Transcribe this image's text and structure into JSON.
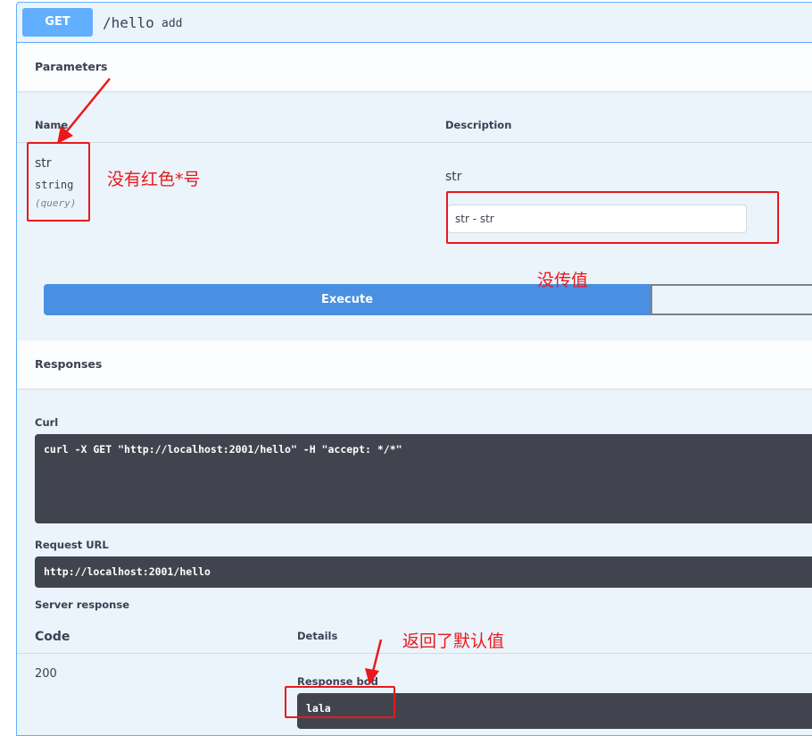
{
  "endpoint": {
    "method": "GET",
    "path": "/hello",
    "summary": "add"
  },
  "parameters": {
    "title": "Parameters",
    "name_header": "Name",
    "description_header": "Description",
    "items": [
      {
        "name": "str",
        "type": "string",
        "location": "(query)",
        "description": "str",
        "input_value": "",
        "input_placeholder": "str - str"
      }
    ]
  },
  "actions": {
    "execute_label": "Execute"
  },
  "responses": {
    "title": "Responses",
    "curl_label": "Curl",
    "curl_command": "curl -X GET \"http://localhost:2001/hello\" -H \"accept: */*\"",
    "request_url_label": "Request URL",
    "request_url": "http://localhost:2001/hello",
    "server_response_label": "Server response",
    "code_header": "Code",
    "details_header": "Details",
    "code": "200",
    "response_body_label": "Response bod",
    "response_body": "lala"
  },
  "annotations": {
    "no_red_asterisk": "没有红色*号",
    "no_value_passed": "没传值",
    "returned_default": "返回了默认值"
  },
  "colors": {
    "get_method": "#61affe",
    "execute_button": "#4990e2",
    "annotation_red": "#e8191d",
    "code_background": "#41444e"
  }
}
